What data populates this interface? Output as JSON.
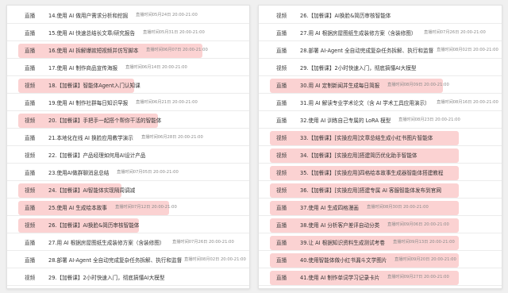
{
  "left_list": [
    {
      "type": "直播",
      "title": "14.使用 AI 做用户需求分析和挖掘",
      "time": "直播时间05月24日 20:00-21:00",
      "highlighted": false
    },
    {
      "type": "直播",
      "title": "15.使用 AI 快速总结长文章/研究报告",
      "time": "直播时间05月31日 20:00-21:00",
      "highlighted": false
    },
    {
      "type": "直播",
      "title": "16.使用 AI 拆解爆款短视频并仿写脚本",
      "time": "直播时间06月07日 20:00-21:00",
      "highlighted": true
    },
    {
      "type": "直播",
      "title": "17.使用 AI 制作商品宣传海报",
      "time": "直播时间06月14日 20:00-21:00",
      "highlighted": false
    },
    {
      "type": "视频",
      "title": "18.【加餐课】智能体Agent入门认知课",
      "time": "",
      "highlighted": true
    },
    {
      "type": "直播",
      "title": "19.使用 AI 制作社群每日知识早报",
      "time": "直播时间06月21日 20:00-21:00",
      "highlighted": false
    },
    {
      "type": "视频",
      "title": "20.【加餐课】手把手一起搭个帮你干活的智能体",
      "time": "",
      "highlighted": true
    },
    {
      "type": "直播",
      "title": "21.本地化在线 AI 换脸应用教学演示",
      "time": "直播时间06月28日 20:00-21:00",
      "highlighted": false
    },
    {
      "type": "视频",
      "title": "22.【加餐课】产品经理如何用AI设计产品",
      "time": "",
      "highlighted": false
    },
    {
      "type": "直播",
      "title": "23.使用AI做群聊消息总结",
      "time": "直播时间07月05日 20:00-21:00",
      "highlighted": false
    },
    {
      "type": "视频",
      "title": "24.【加餐课】AI智能体实现隔周调减",
      "time": "",
      "highlighted": true
    },
    {
      "type": "直播",
      "title": "25.使用 AI 生成绘本故事",
      "time": "直播时间07月12日 20:00-21:00",
      "highlighted": true
    },
    {
      "type": "视频",
      "title": "26.【加餐课】AI换脸&简历审核智能体",
      "time": "",
      "highlighted": true
    },
    {
      "type": "直播",
      "title": "27.用 AI 根据房屋图纸生成装修方案（含装修图）",
      "time": "直播时间07月26日 20:00-21:00",
      "highlighted": false
    },
    {
      "type": "直播",
      "title": "28.部署 AI-Agent 全自动完成复杂任务拆解、执行和监督",
      "time": "直播时间08月02日 20:00-21:00",
      "highlighted": false
    },
    {
      "type": "视频",
      "title": "29.【加餐课】2小时快速入门，彻底搞懂AI大模型",
      "time": "",
      "highlighted": false
    }
  ],
  "right_list": [
    {
      "type": "视频",
      "title": "26.【加餐课】AI换脸&简历审核智能体",
      "time": "",
      "highlighted": false
    },
    {
      "type": "直播",
      "title": "27.用 AI 根据房屋图纸生成装修方案（含装修图）",
      "time": "直播时间07月26日 20:00-21:00",
      "highlighted": false
    },
    {
      "type": "直播",
      "title": "28.部署 AI-Agent 全自动完成复杂任务拆解、执行和监督",
      "time": "直播时间08月02日 20:00-21:00",
      "highlighted": false
    },
    {
      "type": "视频",
      "title": "29.【加餐课】2小时快速入门，彻底搞懂AI大模型",
      "time": "",
      "highlighted": false
    },
    {
      "type": "直播",
      "title": "30.用 AI 定制新闻并生成每日简报",
      "time": "直播时间08月09日 20:00-21:00",
      "highlighted": true
    },
    {
      "type": "直播",
      "title": "31.用 AI 解读专业学术论文（含 AI 学术工具应用演示）",
      "time": "直播时间08月16日 20:00-21:00",
      "highlighted": false
    },
    {
      "type": "直播",
      "title": "32.使用 AI 训练自己专属的 LoRA 模型",
      "time": "直播时间08月23日 20:00-21:00",
      "highlighted": false
    },
    {
      "type": "视频",
      "title": "33.【加餐课】[实操应用]文章总结生成小红书图片智能体",
      "time": "",
      "highlighted": true
    },
    {
      "type": "视频",
      "title": "34.【加餐课】[实操应用]搭建简历优化助手智能体",
      "time": "",
      "highlighted": true
    },
    {
      "type": "视频",
      "title": "35.【加餐课】[实操应用]四格绘本故事生成器智能体搭建教程",
      "time": "",
      "highlighted": true
    },
    {
      "type": "视频",
      "title": "36.【加餐课】[实操应用]搭建专属 AI 客服智能体发布到官网",
      "time": "",
      "highlighted": true
    },
    {
      "type": "直播",
      "title": "37.使用 AI 生成四格漫画",
      "time": "直播时间08月30日 20:00-21:00",
      "highlighted": true
    },
    {
      "type": "直播",
      "title": "38.使用 AI 分析客户差评自动分类",
      "time": "直播时间09月06日 20:00-21:00",
      "highlighted": true
    },
    {
      "type": "直播",
      "title": "39.让 AI 根据知识资料生成测试考卷",
      "time": "直播时间09月13日 20:00-21:00",
      "highlighted": true
    },
    {
      "type": "直播",
      "title": "40.使用智能体做小红书漏斗文学图片",
      "time": "直播时间09月20日 20:00-21:00",
      "highlighted": true
    },
    {
      "type": "直播",
      "title": "41.使用 AI 制作单词学习记录卡片",
      "time": "直播时间09月27日 20:00-21:00",
      "highlighted": true
    }
  ]
}
